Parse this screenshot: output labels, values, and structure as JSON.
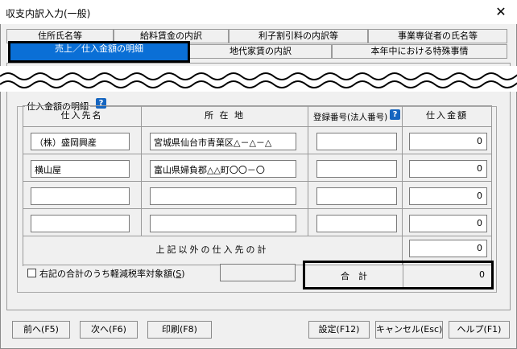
{
  "window": {
    "title": "収支内訳入力(一般)",
    "close_glyph": "✕"
  },
  "tabs_row1": [
    "住所氏名等",
    "給料賃金の内訳",
    "利子割引料の内訳等",
    "事業専従者の氏名等"
  ],
  "tabs_row2": [
    "売上／仕入金額の明細",
    "地代家賃の内訳",
    "本年中における特殊事情"
  ],
  "section": {
    "title": "仕入金額の明細",
    "help_glyph": "?"
  },
  "table": {
    "headers": {
      "name": "仕入先名",
      "address": "所 在 地",
      "reg": "登録番号(法人番号)",
      "amount": "仕入金額"
    },
    "rows": [
      {
        "name": "（株）盛岡興産",
        "address": "宮城県仙台市青葉区△－△－△",
        "reg": "",
        "amount": "0"
      },
      {
        "name": "横山屋",
        "address": "富山県婦負郡△△町〇〇－〇",
        "reg": "",
        "amount": "0"
      },
      {
        "name": "",
        "address": "",
        "reg": "",
        "amount": "0"
      },
      {
        "name": "",
        "address": "",
        "reg": "",
        "amount": "0"
      }
    ],
    "other_label": "上記以外の仕入先の計",
    "other_amount": "0",
    "reduced_label": "右記の合計のうち軽減税率対象額(",
    "reduced_key": "S",
    "reduced_close": ")",
    "reduced_value": "",
    "total_label": "合　計",
    "total_amount": "0"
  },
  "buttons": {
    "prev": "前へ(F5)",
    "next": "次へ(F6)",
    "print": "印刷(F8)",
    "settings": "設定(F12)",
    "cancel": "キャンセル(Esc)",
    "help": "ヘルプ(F1)"
  }
}
